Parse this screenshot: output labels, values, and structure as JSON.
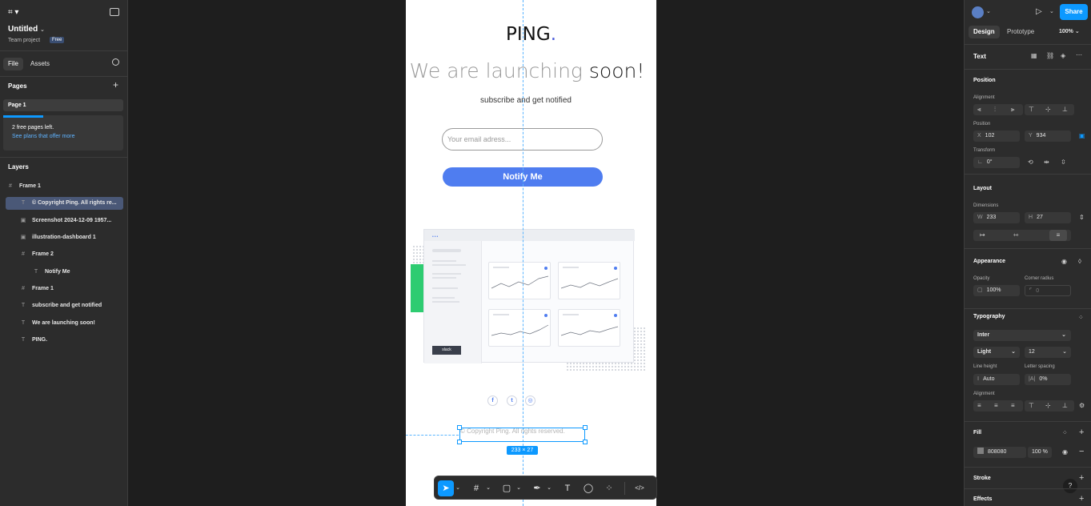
{
  "file": {
    "name": "Untitled",
    "project": "Team project",
    "plan_badge": "Free"
  },
  "left_tabs": {
    "file": "File",
    "assets": "Assets"
  },
  "pages": {
    "title": "Pages",
    "items": [
      "Page 1"
    ],
    "notice_line1": "2 free pages left.",
    "notice_link": "See plans that offer more"
  },
  "layers": {
    "title": "Layers",
    "items": [
      {
        "label": "Frame 1",
        "icon": "#"
      },
      {
        "label": "© Copyright Ping. All rights re...",
        "icon": "T"
      },
      {
        "label": "Screenshot 2024-12-09 1957...",
        "icon": "▣"
      },
      {
        "label": "illustration-dashboard 1",
        "icon": "▣"
      },
      {
        "label": "Frame 2",
        "icon": "#"
      },
      {
        "label": "Notify Me",
        "icon": "T"
      },
      {
        "label": "Frame 1",
        "icon": "#"
      },
      {
        "label": "subscribe and get notified",
        "icon": "T"
      },
      {
        "label": "We are launching soon!",
        "icon": "T"
      },
      {
        "label": "PING.",
        "icon": "T"
      }
    ]
  },
  "design": {
    "logo": "PING",
    "logo_dot": ".",
    "headline_light": "We are launching",
    "headline_dark": " soon!",
    "subline": "subscribe and get notified",
    "email_placeholder": "Your email adress...",
    "notify_button": "Notify Me",
    "copyright": "© Copyright Ping. All rights reserved.",
    "dashboard_badge": "slack",
    "social": [
      "f",
      "t",
      "◎"
    ],
    "selection_size": "233 × 27",
    "accent": "#4f7df0"
  },
  "toolbar": {
    "code": "</>"
  },
  "right": {
    "tabs": {
      "design": "Design",
      "prototype": "Prototype",
      "zoom": "100%"
    },
    "share": "Share",
    "element_type": "Text",
    "position": {
      "title": "Position",
      "alignment_label": "Alignment",
      "position_label": "Position",
      "x_label": "X",
      "x": "102",
      "y_label": "Y",
      "y": "934",
      "transform_label": "Transform",
      "rotation": "0°"
    },
    "layout": {
      "title": "Layout",
      "dimensions_label": "Dimensions",
      "w_label": "W",
      "w": "233",
      "h_label": "H",
      "h": "27"
    },
    "appearance": {
      "title": "Appearance",
      "opacity_label": "Opacity",
      "opacity": "100%",
      "radius_label": "Corner radius",
      "radius": "0"
    },
    "typography": {
      "title": "Typography",
      "font": "Inter",
      "weight": "Light",
      "size": "12",
      "line_height_label": "Line height",
      "line_height": "Auto",
      "letter_spacing_label": "Letter spacing",
      "letter_spacing": "0%",
      "alignment_label": "Alignment"
    },
    "fill": {
      "title": "Fill",
      "hex": "808080",
      "opacity": "100",
      "unit": "%"
    },
    "stroke": {
      "title": "Stroke"
    },
    "effects": {
      "title": "Effects"
    },
    "help": "?"
  }
}
